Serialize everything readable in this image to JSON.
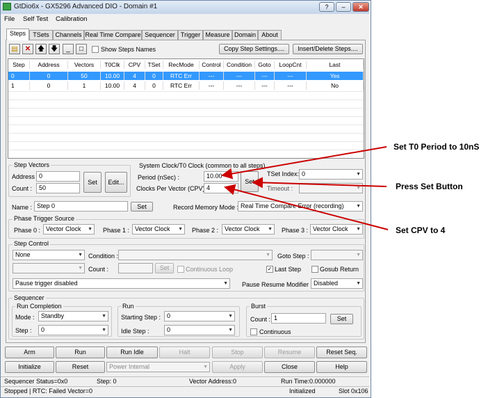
{
  "window": {
    "title": "GtDio6x - GX5296 Advanced DIO - Domain #1",
    "help_button": "?",
    "minimize_button": "–",
    "close_button": "✕"
  },
  "menu": [
    "File",
    "Self Test",
    "Calibration"
  ],
  "tabs": [
    "Steps",
    "TSets",
    "Channels",
    "Real Time Compare",
    "Sequencer",
    "Trigger",
    "Measure",
    "Domain",
    "About"
  ],
  "toolbar": {
    "show_steps_names": "Show Steps Names",
    "copy_step_settings": "Copy Step Settings....",
    "insert_delete_steps": "Insert/Delete Steps...."
  },
  "grid": {
    "headers": [
      "Step",
      "Address",
      "Vectors",
      "T0Clk",
      "CPV",
      "TSet",
      "RecMode",
      "Control",
      "Condition",
      "Goto",
      "LoopCnt",
      "Last"
    ],
    "rows": [
      [
        "0",
        "0",
        "50",
        "10.00",
        "4",
        "0",
        "RTC Err",
        "---",
        "---",
        "---",
        "---",
        "Yes"
      ],
      [
        "1",
        "0",
        "1",
        "10.00",
        "4",
        "0",
        "RTC Err",
        "---",
        "---",
        "---",
        "---",
        "No"
      ]
    ]
  },
  "step_vectors": {
    "title": "Step Vectors",
    "address_label": "Address :",
    "address_value": "0",
    "count_label": "Count :",
    "count_value": "50",
    "set_button": "Set",
    "edit_button": "Edit..."
  },
  "sysclock": {
    "title": "System Clock/T0 Clock (common to all steps)",
    "period_label": "Period (nSec) :",
    "period_value": "10.00",
    "cpv_label": "Clocks Per Vector (CPV):",
    "cpv_value": "4",
    "set_button": "Set",
    "tset_label": "TSet Index:",
    "tset_value": "0",
    "timeout_label": "Timeout :"
  },
  "name_row": {
    "label": "Name :",
    "value": "Step 0",
    "set_button": "Set",
    "record_label": "Record Memory Mode :",
    "record_value": "Real Time Compare Error (recording)"
  },
  "phase": {
    "title": "Phase Trigger Source",
    "items": [
      {
        "label": "Phase 0 :",
        "value": "Vector Clock"
      },
      {
        "label": "Phase 1 :",
        "value": "Vector Clock"
      },
      {
        "label": "Phase 2 :",
        "value": "Vector Clock"
      },
      {
        "label": "Phase 3 :",
        "value": "Vector Clock"
      }
    ]
  },
  "step_control": {
    "title": "Step Control",
    "control_value": "None",
    "condition_label": "Condition :",
    "goto_label": "Goto Step :",
    "count_label": "Count :",
    "set_button": "Set",
    "continuous_loop": "Continuous Loop",
    "last_step": "Last Step",
    "gosub_return": "Gosub Return",
    "pause_trigger_value": "Pause trigger disabled",
    "pause_resume_label": "Pause Resume Modifier :",
    "pause_resume_value": "Disabled"
  },
  "sequencer": {
    "title": "Sequencer",
    "run_completion": {
      "title": "Run Completion",
      "mode_label": "Mode :",
      "mode_value": "Standby",
      "step_label": "Step :",
      "step_value": "0"
    },
    "run": {
      "title": "Run",
      "starting_label": "Starting Step :",
      "starting_value": "0",
      "idle_label": "Idle Step :",
      "idle_value": "0"
    },
    "burst": {
      "title": "Burst",
      "count_label": "Count :",
      "count_value": "1",
      "set_button": "Set",
      "continuous": "Continuous"
    }
  },
  "buttons_row1": [
    "Arm",
    "Run",
    "Run Idle",
    "Halt",
    "Stop",
    "Resume",
    "Reset Seq."
  ],
  "buttons_row2": {
    "initialize": "Initialize",
    "reset": "Reset",
    "power_value": "Power Internal",
    "apply": "Apply",
    "close": "Close",
    "help": "Help"
  },
  "status1": {
    "sequencer_status": "Sequencer Status=0x0",
    "step": "Step: 0",
    "vector_address": "Vector Address:0",
    "run_time": "Run Time:0.000000"
  },
  "status2": {
    "stopped": "Stopped | RTC: Failed Vector=0",
    "initialized": "Initialized",
    "slot": "Slot 0x106"
  },
  "annotations": {
    "set_t0": "Set T0 Period to 10nS",
    "press_set": "Press Set Button",
    "set_cpv": "Set CPV to 4"
  },
  "colors": {
    "selection": "#3399ff",
    "arrow": "#cc0000"
  }
}
